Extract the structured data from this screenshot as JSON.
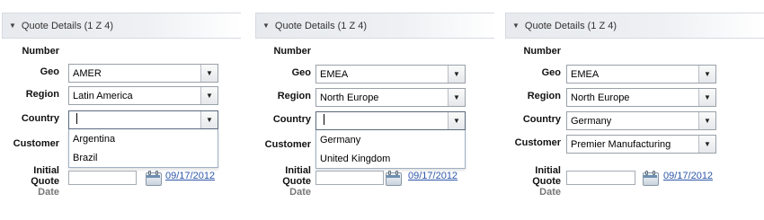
{
  "panels": [
    {
      "header": "Quote Details (1 Z 4)",
      "labels": {
        "number": "Number",
        "geo": "Geo",
        "region": "Region",
        "country": "Country",
        "customer": "Customer",
        "initial": "Initial",
        "quote": "Quote",
        "date": "Date"
      },
      "geo": "AMER",
      "region": "Latin America",
      "country": "",
      "customer": "",
      "dropdown_options": [
        "Argentina",
        "Brazil"
      ],
      "date_value": "09/17/2012"
    },
    {
      "header": "Quote Details (1 Z 4)",
      "labels": {
        "number": "Number",
        "geo": "Geo",
        "region": "Region",
        "country": "Country",
        "customer": "Customer",
        "initial": "Initial",
        "quote": "Quote",
        "date": "Date"
      },
      "geo": "EMEA",
      "region": "North Europe",
      "country": "",
      "customer": "",
      "dropdown_options": [
        "Germany",
        "United Kingdom"
      ],
      "date_value": "09/17/2012"
    },
    {
      "header": "Quote Details (1 Z 4)",
      "labels": {
        "number": "Number",
        "geo": "Geo",
        "region": "Region",
        "country": "Country",
        "customer": "Customer",
        "initial": "Initial",
        "quote": "Quote",
        "date": "Date"
      },
      "geo": "EMEA",
      "region": "North Europe",
      "country": "Germany",
      "customer": "Premier Manufacturing",
      "dropdown_options": [],
      "date_value": "09/17/2012"
    }
  ],
  "icons": {
    "collapse": "triangle-down-icon",
    "dropdown": "chevron-down-icon",
    "calendar": "calendar-icon"
  }
}
